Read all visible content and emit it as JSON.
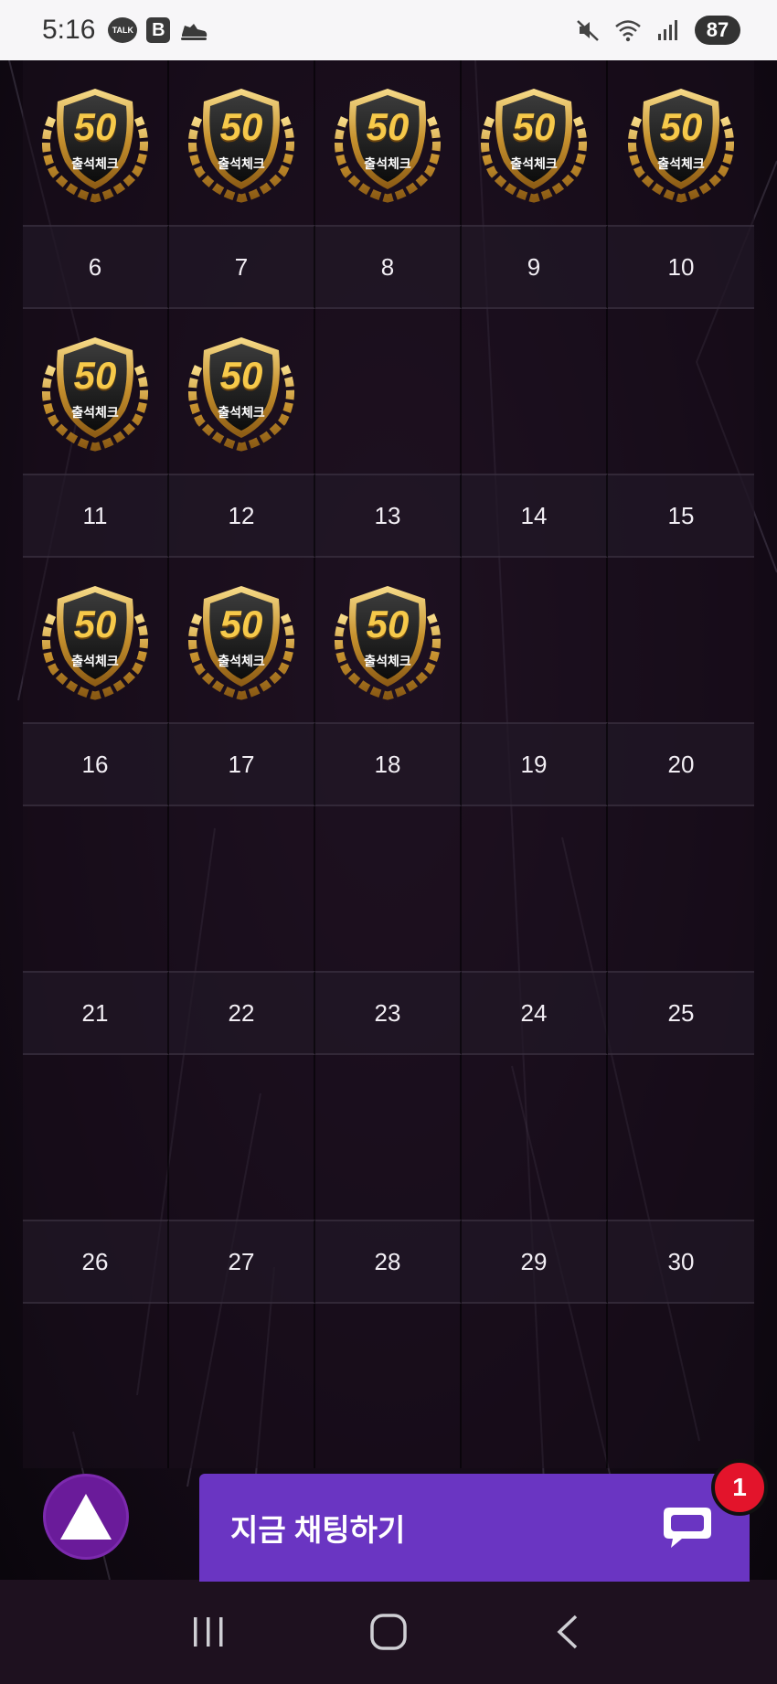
{
  "status_bar": {
    "time": "5:16",
    "talk_label": "TALK",
    "b_label": "B",
    "battery": "87"
  },
  "calendar": {
    "badge_text": "50",
    "badge_caption": "출석체크",
    "weeks": [
      {
        "badges": [
          true,
          true,
          true,
          true,
          true
        ],
        "days": []
      },
      {
        "badges": [
          true,
          true,
          false,
          false,
          false
        ],
        "days": [
          "6",
          "7",
          "8",
          "9",
          "10"
        ]
      },
      {
        "badges": [
          true,
          true,
          true,
          false,
          false
        ],
        "days": [
          "11",
          "12",
          "13",
          "14",
          "15"
        ]
      },
      {
        "badges": [
          false,
          false,
          false,
          false,
          false
        ],
        "days": [
          "16",
          "17",
          "18",
          "19",
          "20"
        ]
      },
      {
        "badges": [
          false,
          false,
          false,
          false,
          false
        ],
        "days": [
          "21",
          "22",
          "23",
          "24",
          "25"
        ]
      },
      {
        "badges": [
          false,
          false,
          false,
          false,
          false
        ],
        "days": [
          "26",
          "27",
          "28",
          "29",
          "30"
        ]
      }
    ]
  },
  "chat": {
    "label": "지금 채팅하기",
    "badge_count": "1"
  },
  "colors": {
    "chat_button": "#6a35c2",
    "scroll_top_button": "#6a1b9a",
    "badge_red": "#e3142b"
  }
}
